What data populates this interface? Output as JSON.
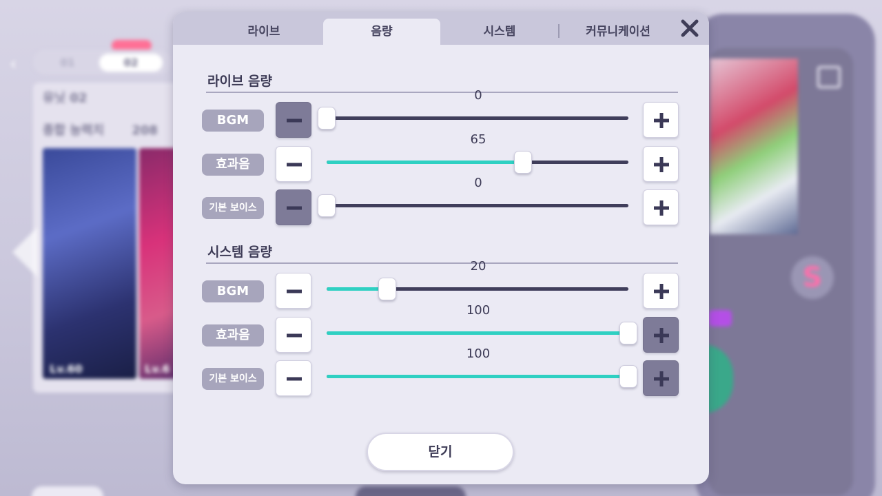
{
  "background": {
    "tabs": [
      "01",
      "02"
    ],
    "unit_name": "유닛 02",
    "power_label": "종합 능력치",
    "power_value": "208",
    "card_levels": [
      "Lv.60",
      "Lv.6"
    ]
  },
  "dialog": {
    "tabs": [
      {
        "label": "라이브",
        "active": false
      },
      {
        "label": "음량",
        "active": true
      },
      {
        "label": "시스템",
        "active": false
      },
      {
        "label": "커뮤니케이션",
        "active": false
      }
    ],
    "close_icon": "close-icon",
    "sections": [
      {
        "title": "라이브 음량",
        "rows": [
          {
            "label": "BGM",
            "value": "0",
            "fraction": 0.0
          },
          {
            "label": "효과음",
            "value": "65",
            "fraction": 0.65
          },
          {
            "label": "기본 보이스",
            "value": "0",
            "fraction": 0.0
          }
        ]
      },
      {
        "title": "시스템 음량",
        "rows": [
          {
            "label": "BGM",
            "value": "20",
            "fraction": 0.2
          },
          {
            "label": "효과음",
            "value": "100",
            "fraction": 1.0
          },
          {
            "label": "기본 보이스",
            "value": "100",
            "fraction": 1.0
          }
        ]
      }
    ],
    "close_button_label": "닫기"
  },
  "colors": {
    "accent_fill": "#2fd0c2",
    "track": "#403e5b",
    "disabled_button": "#7e7b98",
    "label_bg": "#a7a5bc"
  }
}
